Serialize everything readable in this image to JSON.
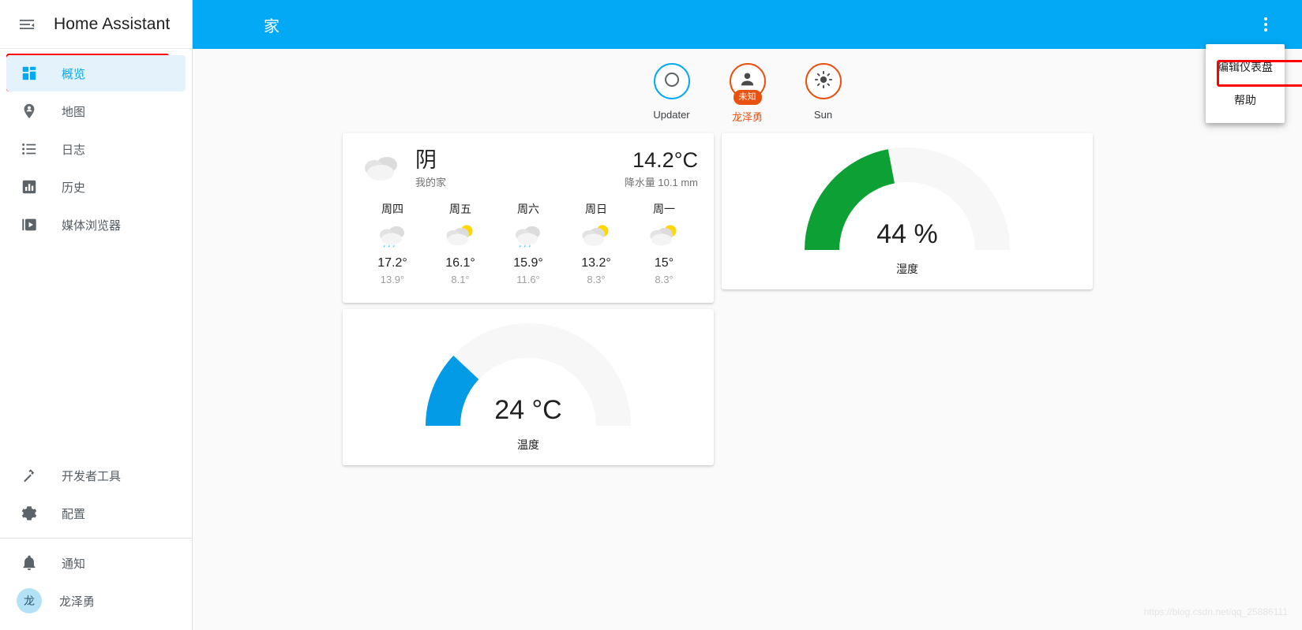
{
  "sidebar": {
    "title": "Home Assistant",
    "menu_icon": "menu-collapse-icon",
    "items": [
      {
        "label": "概览",
        "icon": "view-dashboard-icon",
        "selected": true
      },
      {
        "label": "地图",
        "icon": "map-marker-account-icon",
        "selected": false
      },
      {
        "label": "日志",
        "icon": "format-list-bulleted-icon",
        "selected": false
      },
      {
        "label": "历史",
        "icon": "chart-box-icon",
        "selected": false
      },
      {
        "label": "媒体浏览器",
        "icon": "play-box-icon",
        "selected": false
      }
    ],
    "bottom_items": [
      {
        "label": "开发者工具",
        "icon": "hammer-wrench-icon"
      },
      {
        "label": "配置",
        "icon": "cog-icon"
      }
    ],
    "footer_items": [
      {
        "label": "通知",
        "icon": "bell-icon"
      }
    ],
    "user": {
      "label": "龙泽勇",
      "avatar_initial": "龙"
    }
  },
  "topbar": {
    "title": "家",
    "overflow_icon": "dots-vertical-icon",
    "accent_color": "#03a9f4"
  },
  "dropdown": {
    "items": [
      {
        "label": "编辑仪表盘",
        "highlighted": true
      },
      {
        "label": "帮助",
        "highlighted": false
      }
    ]
  },
  "badges": [
    {
      "label": "Updater",
      "icon": "circle-outline-icon",
      "ring_color": "#03a9f4",
      "state": ""
    },
    {
      "label": "龙泽勇",
      "icon": "account-icon",
      "ring_color": "#e8510f",
      "state": "未知"
    },
    {
      "label": "Sun",
      "icon": "weather-sunny-icon",
      "ring_color": "#e8510f",
      "state": ""
    }
  ],
  "weather": {
    "condition": "阴",
    "location": "我的家",
    "temperature": "14.2°C",
    "precipitation": "降水量 10.1 mm",
    "icon": "weather-cloudy-icon",
    "forecast": [
      {
        "day": "周四",
        "icon": "weather-rainy-icon",
        "high": "17.2°",
        "low": "13.9°"
      },
      {
        "day": "周五",
        "icon": "weather-partly-cloudy-icon",
        "high": "16.1°",
        "low": "8.1°"
      },
      {
        "day": "周六",
        "icon": "weather-rainy-icon",
        "high": "15.9°",
        "low": "11.6°"
      },
      {
        "day": "周日",
        "icon": "weather-partly-cloudy-icon",
        "high": "13.2°",
        "low": "8.3°"
      },
      {
        "day": "周一",
        "icon": "weather-partly-cloudy-icon",
        "high": "15°",
        "low": "8.3°"
      }
    ]
  },
  "gauges": [
    {
      "name": "humidity",
      "value": "44 %",
      "label": "湿度",
      "percent": 44,
      "color": "#0da035",
      "track_color": "#f7f7f7"
    },
    {
      "name": "temperature",
      "value": "24 °C",
      "label": "温度",
      "percent": 24,
      "color": "#039be5",
      "track_color": "#f7f7f7"
    }
  ],
  "watermark": "https://blog.csdn.net/qq_25886111"
}
